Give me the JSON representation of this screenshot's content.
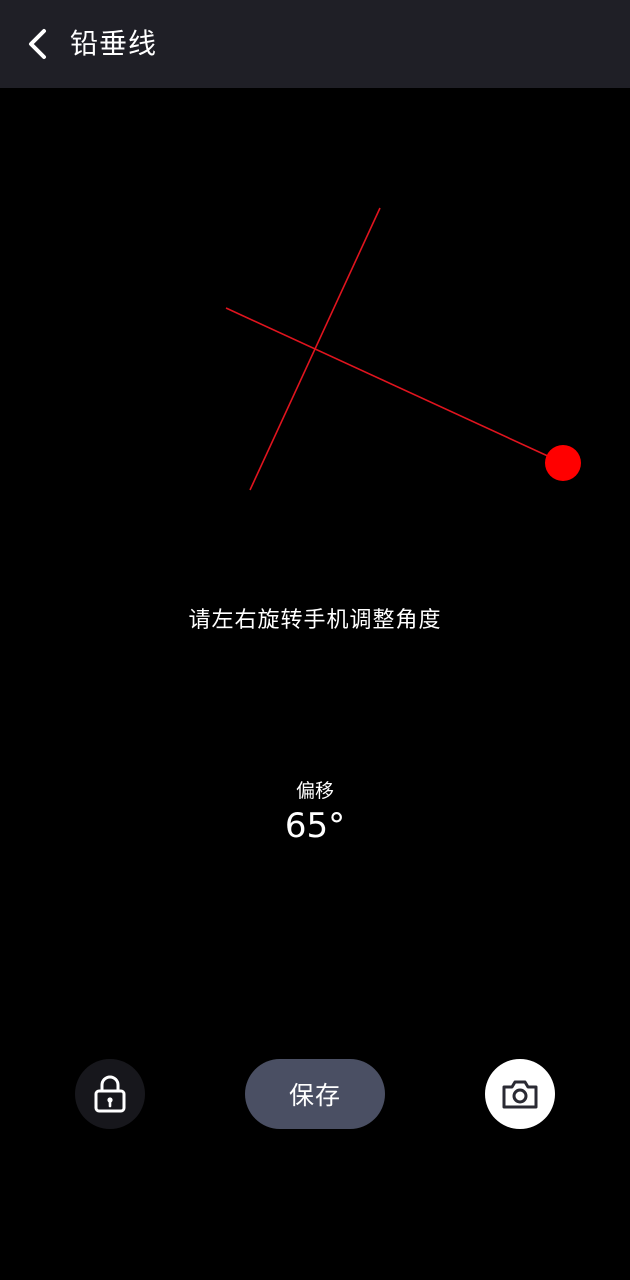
{
  "header": {
    "title": "铅垂线",
    "back_icon": "chevron-left-icon"
  },
  "plumb": {
    "line_color": "#e0141e",
    "bob_color": "#ff0000"
  },
  "hint": "请左右旋转手机调整角度",
  "offset": {
    "label": "偏移",
    "value": "65°"
  },
  "controls": {
    "lock_icon": "lock-icon",
    "save_label": "保存",
    "camera_icon": "camera-icon"
  }
}
